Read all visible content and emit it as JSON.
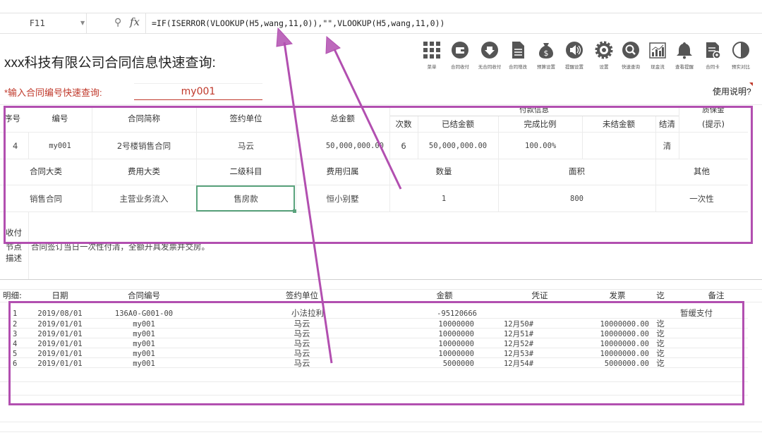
{
  "formula_bar": {
    "name_box": "F11",
    "formula": "=IF(ISERROR(VLOOKUP(H5,wang,11,0)),\"\",VLOOKUP(H5,wang,11,0))"
  },
  "toolbar": [
    {
      "label": "菜单",
      "icon": "grid-icon"
    },
    {
      "label": "合同收付",
      "icon": "wallet-icon"
    },
    {
      "label": "无合同收付",
      "icon": "download-icon"
    },
    {
      "label": "合同增改",
      "icon": "document-icon"
    },
    {
      "label": "预算设置",
      "icon": "money-bag-icon"
    },
    {
      "label": "提醒设置",
      "icon": "speaker-icon"
    },
    {
      "label": "设置",
      "icon": "gear-icon"
    },
    {
      "label": "快速查询",
      "icon": "search-icon"
    },
    {
      "label": "现金流",
      "icon": "chart-icon"
    },
    {
      "label": "查看提醒",
      "icon": "bell-icon"
    },
    {
      "label": "合同卡",
      "icon": "card-icon"
    },
    {
      "label": "预实对比",
      "icon": "contrast-icon"
    }
  ],
  "header": {
    "title": "xxx科技有限公司合同信息快速查询:",
    "query_label": "*输入合同编号快速查询:",
    "query_value": "my001",
    "help": "使用说明?"
  },
  "info_table": {
    "group_payment": "付款信息",
    "group_deposit": "质保金",
    "deposit_hint": "(提示)",
    "headers": [
      "序号",
      "编号",
      "合同简称",
      "签约单位",
      "总金额",
      "次数",
      "已结金额",
      "完成比例",
      "未结金额",
      "结清"
    ],
    "row": [
      "4",
      "my001",
      "2号楼销售合同",
      "马云",
      "50,000,000.00",
      "6",
      "50,000,000.00",
      "100.00%",
      "",
      "清"
    ],
    "headers2": [
      "合同大类",
      "费用大类",
      "二级科目",
      "费用归属",
      "数量",
      "面积",
      "其他"
    ],
    "row2": [
      "销售合同",
      "主营业务流入",
      "售房款",
      "恒小别墅",
      "1",
      "800",
      "一次性"
    ],
    "pay_label": "收付",
    "pay_label2": "节点",
    "desc_label": "描述",
    "desc_text": "合同签订当日一次性付清，全额开具发票并交房。"
  },
  "detail_table": {
    "headers": [
      "明细:",
      "日期",
      "合同编号",
      "签约单位",
      "金额",
      "凭证",
      "发票",
      "讫",
      "备注"
    ],
    "rows": [
      [
        "1",
        "2019/08/01",
        "136A0-G001-00",
        "小法拉利",
        "-95120666",
        "",
        "",
        "",
        "暂缓支付"
      ],
      [
        "2",
        "2019/01/01",
        "my001",
        "马云",
        "10000000",
        "12月50#",
        "10000000.00",
        "讫",
        ""
      ],
      [
        "3",
        "2019/01/01",
        "my001",
        "马云",
        "10000000",
        "12月51#",
        "10000000.00",
        "讫",
        ""
      ],
      [
        "4",
        "2019/01/01",
        "my001",
        "马云",
        "10000000",
        "12月52#",
        "10000000.00",
        "讫",
        ""
      ],
      [
        "5",
        "2019/01/01",
        "my001",
        "马云",
        "10000000",
        "12月53#",
        "10000000.00",
        "讫",
        ""
      ],
      [
        "6",
        "2019/01/01",
        "my001",
        "马云",
        "5000000",
        "12月54#",
        "5000000.00",
        "讫",
        ""
      ]
    ]
  },
  "colors": {
    "annotation": "#b24fb0",
    "accent": "#c0392b",
    "selection": "#5aa37d"
  }
}
